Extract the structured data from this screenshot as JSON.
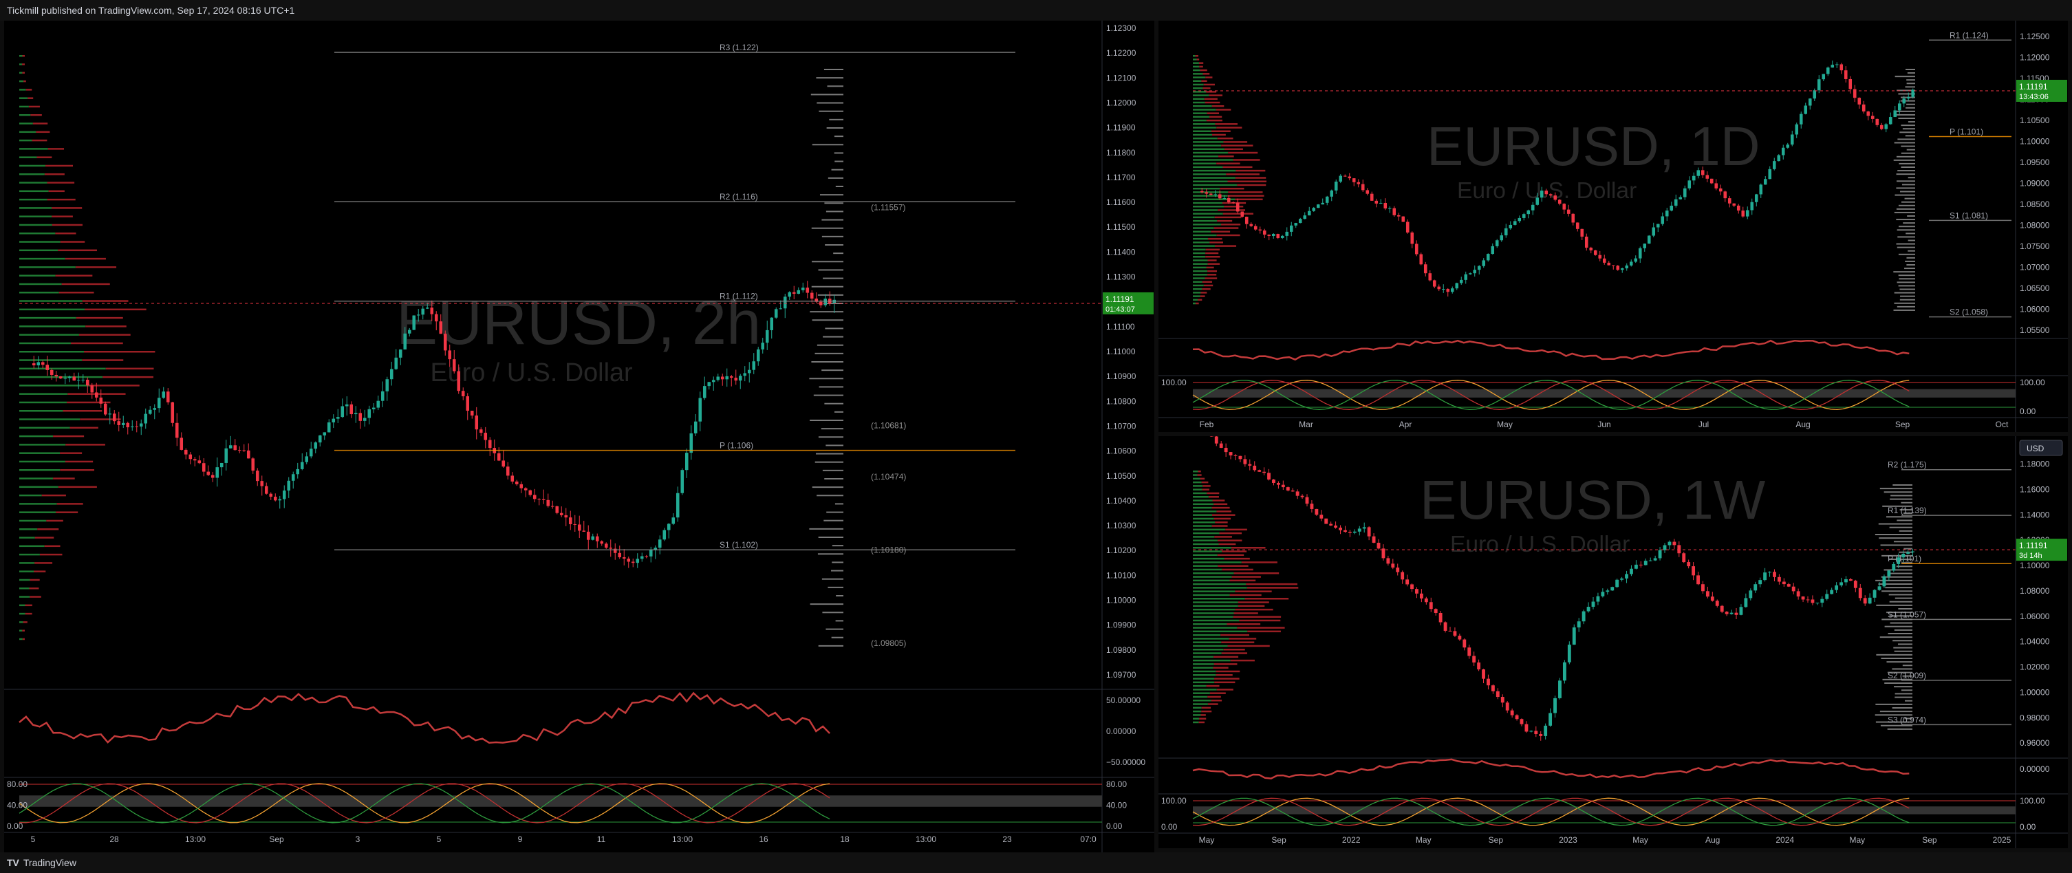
{
  "header": {
    "publish_text": "Tickmill published on TradingView.com, Sep 17, 2024 08:16 UTC+1"
  },
  "footer": {
    "brand": "TradingView"
  },
  "colors": {
    "up": "#22ab94",
    "down": "#f23645",
    "background": "#000000",
    "accent": "#ff9800",
    "price_tag": "#1e8c1e"
  },
  "panels": {
    "left": {
      "watermark_symbol": "EURUSD, 2h",
      "watermark_desc": "Euro / U.S. Dollar",
      "price_tag": "1.11191",
      "price_countdown": "01:43:07",
      "price_axis": [
        "1.12300",
        "1.12200",
        "1.12100",
        "1.12000",
        "1.11900",
        "1.11800",
        "1.11700",
        "1.11600",
        "1.11500",
        "1.11400",
        "1.11300",
        "1.11200",
        "1.11100",
        "1.11000",
        "1.10900",
        "1.10800",
        "1.10700",
        "1.10600",
        "1.10500",
        "1.10400",
        "1.10300",
        "1.10200",
        "1.10100",
        "1.10000",
        "1.09900",
        "1.09800",
        "1.09700"
      ],
      "level_labels": [
        "R3 (1.122)",
        "R2 (1.116)",
        "R1 (1.112)",
        "P (1.106)",
        "S1 (1.102)",
        "(1.11557)",
        "(1.10681)",
        "(1.10474)",
        "(1.10180)",
        "(1.09805)"
      ],
      "osc1_axis": [
        "50.00000",
        "0.00000",
        "−50.00000"
      ],
      "osc2_axis": [
        "80.00",
        "40.00",
        "0.00"
      ],
      "osc2_left_labels": [
        "80.00",
        "40.00",
        "0.00"
      ],
      "time_axis": [
        "5",
        "28",
        "13:00",
        "Sep",
        "3",
        "5",
        "9",
        "11",
        "13:00",
        "16",
        "18",
        "13:00",
        "23",
        "07:0"
      ]
    },
    "top_right": {
      "watermark_symbol": "EURUSD, 1D",
      "watermark_desc": "Euro / U.S. Dollar",
      "price_tag": "1.11191",
      "price_countdown": "13:43:06",
      "price_axis": [
        "1.12500",
        "1.12000",
        "1.11500",
        "1.11000",
        "1.10500",
        "1.10000",
        "1.09500",
        "1.09000",
        "1.08500",
        "1.08000",
        "1.07500",
        "1.07000",
        "1.06500",
        "1.06000",
        "1.05500"
      ],
      "level_labels": [
        "R1 (1.124)",
        "P (1.101)",
        "S1 (1.081)",
        "S2 (1.058)"
      ],
      "osc2_axis": [
        "100.00",
        "0.00"
      ],
      "osc2_left_labels": [
        "100.00"
      ],
      "time_axis": [
        "Feb",
        "Mar",
        "Apr",
        "May",
        "Jun",
        "Jul",
        "Aug",
        "Sep",
        "Oct"
      ]
    },
    "bottom_right": {
      "watermark_symbol": "EURUSD, 1W",
      "watermark_desc": "Euro / U.S. Dollar",
      "currency_button": "USD",
      "price_tag": "1.11191",
      "price_countdown": "3d 14h",
      "price_axis": [
        "1.18000",
        "1.16000",
        "1.14000",
        "1.12000",
        "1.10000",
        "1.08000",
        "1.06000",
        "1.04000",
        "1.02000",
        "1.00000",
        "0.98000",
        "0.96000"
      ],
      "level_labels": [
        "R2 (1.175)",
        "R1 (1.139)",
        "P (1.101)",
        "S1 (1.057)",
        "S2 (1.009)",
        "S3 (0.974)"
      ],
      "osc1_axis": [
        "0.00000"
      ],
      "osc2_axis": [
        "100.00",
        "0.00"
      ],
      "osc2_left_labels": [
        "100.00",
        "0.00"
      ],
      "time_axis": [
        "May",
        "Sep",
        "2022",
        "May",
        "Sep",
        "2023",
        "May",
        "Aug",
        "2024",
        "May",
        "Sep",
        "2025"
      ]
    }
  },
  "chart_data": [
    {
      "type": "candlestick",
      "symbol": "EURUSD",
      "timeframe": "2h",
      "title": "EURUSD, 2h",
      "last_price": 1.11191,
      "ylim": [
        1.097,
        1.123
      ],
      "pivots": {
        "R3": 1.122,
        "R2": 1.116,
        "R1": 1.112,
        "P": 1.106,
        "S1": 1.102
      },
      "marked_levels": [
        1.11557,
        1.10681,
        1.10474,
        1.1018,
        1.09805
      ],
      "close_path": [
        1.1095,
        1.1092,
        1.1088,
        1.109,
        1.1078,
        1.1072,
        1.1068,
        1.1075,
        1.1083,
        1.106,
        1.1055,
        1.105,
        1.1062,
        1.1058,
        1.1045,
        1.104,
        1.1052,
        1.106,
        1.107,
        1.1078,
        1.1072,
        1.108,
        1.1095,
        1.111,
        1.112,
        1.1105,
        1.1085,
        1.107,
        1.106,
        1.105,
        1.1045,
        1.104,
        1.1035,
        1.103,
        1.1025,
        1.102,
        1.1018,
        1.1015,
        1.1022,
        1.103,
        1.106,
        1.1085,
        1.109,
        1.1088,
        1.1095,
        1.111,
        1.1122,
        1.1125,
        1.112,
        1.1119
      ]
    },
    {
      "type": "candlestick",
      "symbol": "EURUSD",
      "timeframe": "1D",
      "title": "EURUSD, 1D",
      "last_price": 1.11191,
      "ylim": [
        1.054,
        1.127
      ],
      "pivots": {
        "R1": 1.124,
        "P": 1.101,
        "S1": 1.081,
        "S2": 1.058
      },
      "close_path": [
        1.088,
        1.087,
        1.085,
        1.08,
        1.078,
        1.077,
        1.08,
        1.083,
        1.086,
        1.092,
        1.09,
        1.086,
        1.084,
        1.081,
        1.072,
        1.065,
        1.064,
        1.068,
        1.07,
        1.076,
        1.08,
        1.083,
        1.088,
        1.086,
        1.081,
        1.074,
        1.071,
        1.069,
        1.072,
        1.078,
        1.083,
        1.087,
        1.093,
        1.09,
        1.086,
        1.082,
        1.088,
        1.095,
        1.1,
        1.108,
        1.115,
        1.119,
        1.112,
        1.106,
        1.103,
        1.108,
        1.1119
      ]
    },
    {
      "type": "candlestick",
      "symbol": "EURUSD",
      "timeframe": "1W",
      "title": "EURUSD, 1W",
      "last_price": 1.11191,
      "ylim": [
        0.952,
        1.196
      ],
      "pivots": {
        "R2": 1.175,
        "R1": 1.139,
        "P": 1.101,
        "S1": 1.057,
        "S2": 1.009,
        "S3": 0.974
      },
      "close_path": [
        1.21,
        1.195,
        1.185,
        1.178,
        1.17,
        1.16,
        1.155,
        1.14,
        1.13,
        1.125,
        1.13,
        1.11,
        1.095,
        1.08,
        1.07,
        1.05,
        1.04,
        1.02,
        1.0,
        0.985,
        0.97,
        0.965,
        1.0,
        1.05,
        1.07,
        1.08,
        1.09,
        1.1,
        1.105,
        1.12,
        1.1,
        1.08,
        1.065,
        1.06,
        1.08,
        1.095,
        1.085,
        1.075,
        1.07,
        1.08,
        1.09,
        1.07,
        1.085,
        1.105,
        1.1119
      ]
    }
  ]
}
